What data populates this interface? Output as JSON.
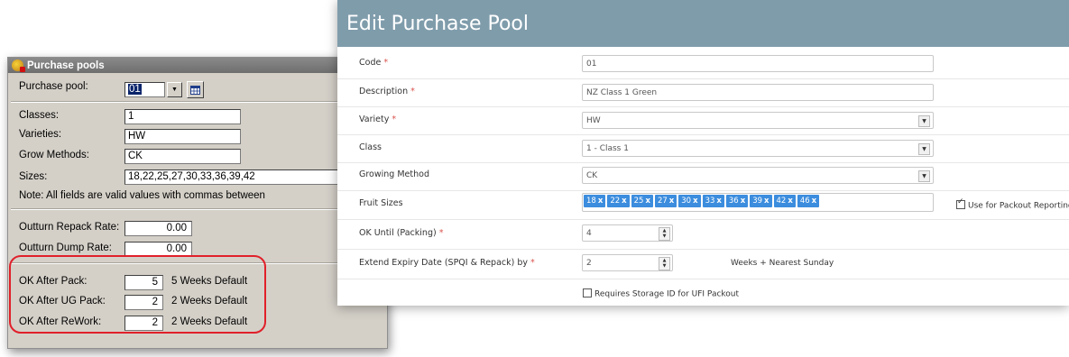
{
  "legacy": {
    "title": "Purchase pools",
    "purchase_pool_label": "Purchase pool:",
    "purchase_pool_value": "01",
    "classes_label": "Classes:",
    "classes_value": "1",
    "varieties_label": "Varieties:",
    "varieties_value": "HW",
    "grow_methods_label": "Grow Methods:",
    "grow_methods_value": "CK",
    "sizes_label": "Sizes:",
    "sizes_value": "18,22,25,27,30,33,36,39,42",
    "note": "Note: All fields are valid values with commas between",
    "outturn_repack_label": "Outturn Repack Rate:",
    "outturn_repack_value": "0.00",
    "outturn_dump_label": "Outturn Dump Rate:",
    "outturn_dump_value": "0.00",
    "ok_after_pack_label": "OK After Pack:",
    "ok_after_pack_value": "5",
    "ok_after_pack_default": "5 Weeks Default",
    "ok_after_ug_pack_label": "OK After UG Pack:",
    "ok_after_ug_pack_value": "2",
    "ok_after_ug_pack_default": "2 Weeks Default",
    "ok_after_rework_label": "OK After ReWork:",
    "ok_after_rework_value": "2",
    "ok_after_rework_default": "2 Weeks Default",
    "highlight_color": "#e0202a"
  },
  "modern": {
    "title": "Edit Purchase Pool",
    "header_color": "#7f9cab",
    "code_label": "Code",
    "code_value": "01",
    "description_label": "Description",
    "description_value": "NZ Class 1 Green",
    "variety_label": "Variety",
    "variety_value": "HW",
    "class_label": "Class",
    "class_value": "1 - Class 1",
    "growing_method_label": "Growing Method",
    "growing_method_value": "CK",
    "fruit_sizes_label": "Fruit Sizes",
    "fruit_sizes": [
      "18",
      "22",
      "25",
      "27",
      "30",
      "33",
      "36",
      "39",
      "42",
      "46"
    ],
    "tag_remove_glyph": "x",
    "tag_color": "#3c8dde",
    "use_for_packout_label": "Use for Packout Reporting",
    "use_for_packout_checked": true,
    "ok_until_label": "OK Until (Packing)",
    "ok_until_value": "4",
    "extend_expiry_label": "Extend Expiry Date (SPQI & Repack) by",
    "extend_expiry_value": "2",
    "extend_expiry_suffix": "Weeks + Nearest Sunday",
    "requires_storage_label": "Requires Storage ID for UFI Packout",
    "requires_storage_checked": false,
    "required_marker": "*"
  }
}
